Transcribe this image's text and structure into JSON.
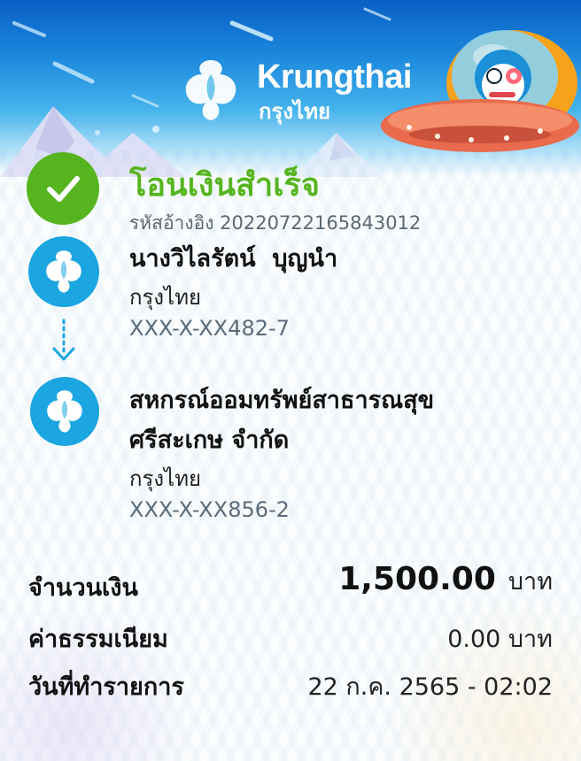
{
  "brand": {
    "name_en": "Krungthai",
    "name_th": "กรุงไทย"
  },
  "status": {
    "title": "โอนเงินสำเร็จ",
    "reference": "รหัสอ้างอิง 20220722165843012"
  },
  "sender": {
    "name": "นางวิไลรัตน์  บุญนำ",
    "bank": "กรุงไทย",
    "account": "XXX-X-XX482-7"
  },
  "receiver": {
    "name_line1": "สหกรณ์ออมทรัพย์สาธารณสุข",
    "name_line2": "ศรีสะเกษ จำกัด",
    "bank": "กรุงไทย",
    "account": "XXX-X-XX856-2"
  },
  "summary": {
    "amount_label": "จำนวนเงิน",
    "amount_value": "1,500.00",
    "amount_unit": "บาท",
    "fee_label": "ค่าธรรมเนียม",
    "fee_value": "0.00 บาท",
    "date_label": "วันที่ทำรายการ",
    "date_value": "22 ก.ค. 2565 - 02:02"
  },
  "icons": {
    "success": "check-icon",
    "bank_logo": "krungthai-bird-logo",
    "arrow": "down-arrow-icon",
    "mascot": "ufo-mascot"
  },
  "colors": {
    "success_green": "#56b51f",
    "brand_blue": "#1ba5e1",
    "header_blue": "#0a5fc4"
  }
}
